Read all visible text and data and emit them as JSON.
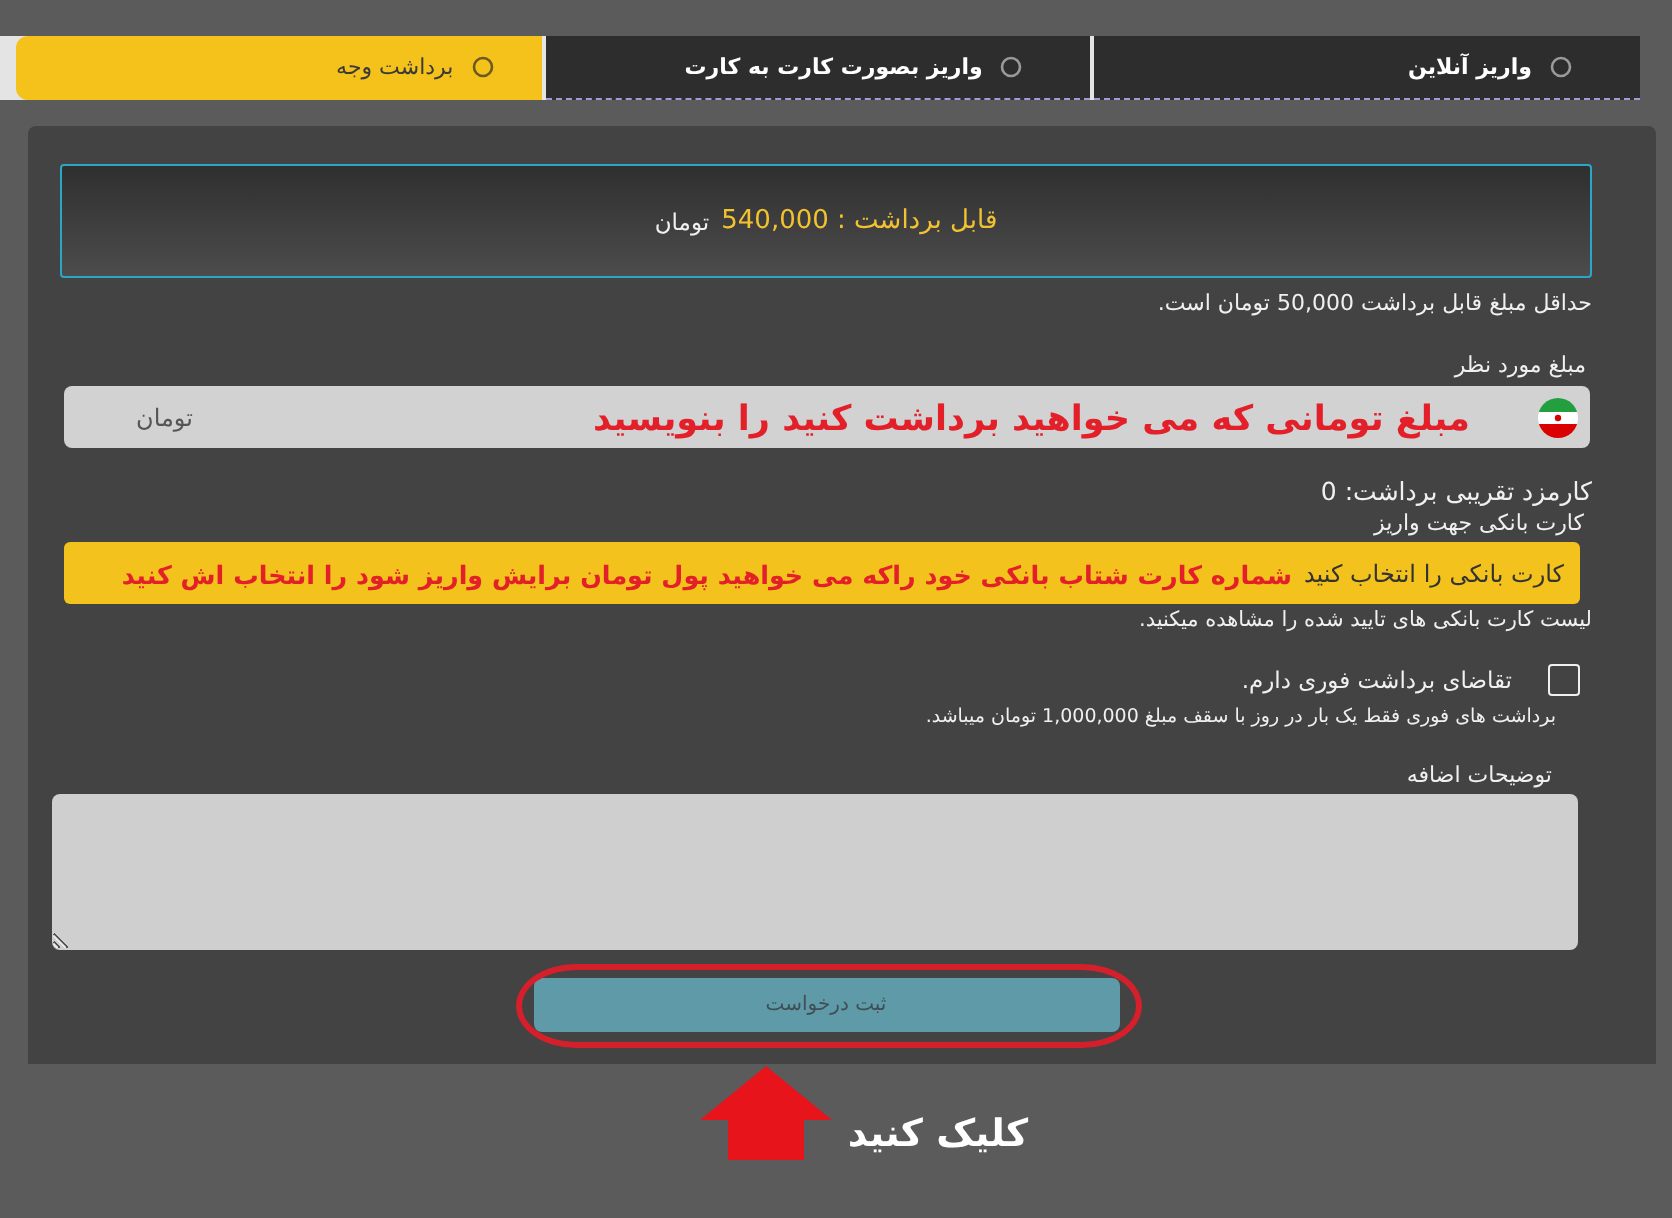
{
  "tabs": [
    {
      "label": "واریز آنلاین",
      "selected": false
    },
    {
      "label": "واریز بصورت کارت به کارت",
      "selected": false
    },
    {
      "label": "برداشت وجه",
      "selected": true
    }
  ],
  "balance": {
    "text": "قابل برداشت : 540,000",
    "currency": "تومان"
  },
  "min_note": "حداقل مبلغ قابل برداشت 50,000 تومان است.",
  "amount": {
    "label": "مبلغ مورد نظر",
    "suffix": "تومان",
    "annotation": "مبلغ تومانی که می خواهید برداشت کنید را بنویسید"
  },
  "fee": "کارمزد تقریبی برداشت: 0",
  "bank_card": {
    "label": "کارت بانکی جهت واریز",
    "value": "کارت بانکی را انتخاب کنید",
    "annotation": "شماره کارت شتاب بانکی خود راکه می خواهید پول تومان برایش واریز شود را انتخاب اش کنید",
    "hint": "لیست کارت بانکی های تایید شده را مشاهده میکنید."
  },
  "instant": {
    "label": "تقاضای برداشت فوری دارم.",
    "checked": false,
    "hint": "برداشت های فوری فقط یک بار در روز با سقف مبلغ 1,000,000 تومان میباشد."
  },
  "notes": {
    "label": "توضیحات اضافه"
  },
  "submit": {
    "label": "ثبت درخواست",
    "highlighted": true
  },
  "callout": {
    "text": "کلیک کنید"
  }
}
